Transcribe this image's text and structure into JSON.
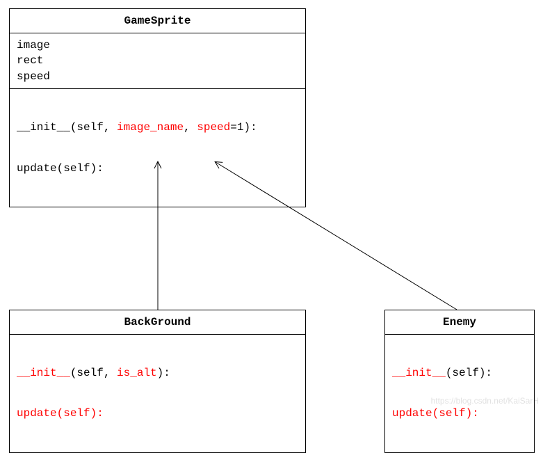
{
  "classes": {
    "gameSprite": {
      "name": "GameSprite",
      "attrs": [
        "image",
        "rect",
        "speed"
      ],
      "method1": {
        "pre": "__init__(self, ",
        "p1": "image_name",
        "sep": ", ",
        "p2": "speed",
        "post": "=1):"
      },
      "method2": "update(self):"
    },
    "background": {
      "name": "BackGround",
      "method1": {
        "fn": "__init__",
        "mid": "(self, ",
        "p1": "is_alt",
        "post": "):"
      },
      "method2": "update(self):"
    },
    "enemy": {
      "name": "Enemy",
      "method1": {
        "fn": "__init__",
        "post": "(self):"
      },
      "method2": "update(self):"
    }
  },
  "watermark": "https://blog.csdn.net/KaiSarH"
}
